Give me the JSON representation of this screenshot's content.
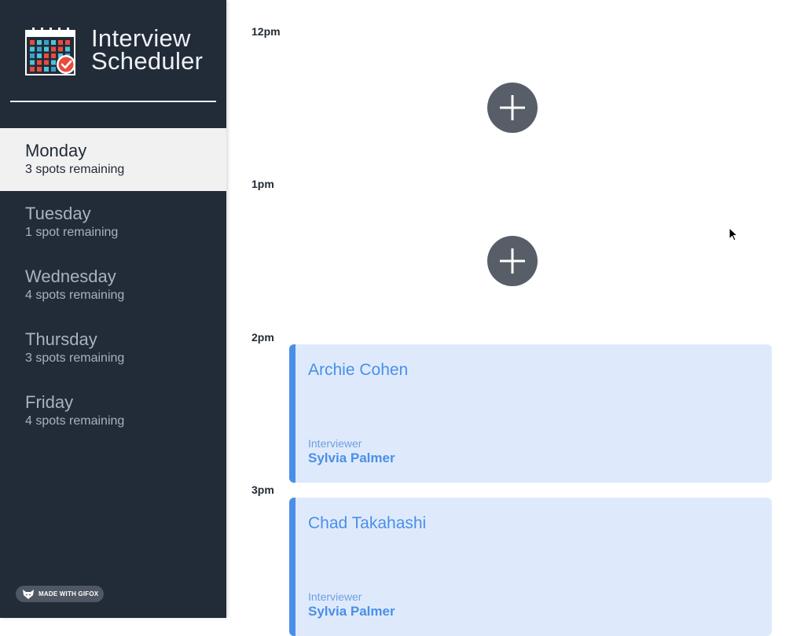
{
  "app": {
    "title_line1": "Interview",
    "title_line2": "Scheduler",
    "logo_icon": "calendar-check-icon"
  },
  "days": [
    {
      "name": "Monday",
      "spots": "3 spots remaining",
      "selected": true
    },
    {
      "name": "Tuesday",
      "spots": "1 spot remaining",
      "selected": false
    },
    {
      "name": "Wednesday",
      "spots": "4 spots remaining",
      "selected": false
    },
    {
      "name": "Thursday",
      "spots": "3 spots remaining",
      "selected": false
    },
    {
      "name": "Friday",
      "spots": "4 spots remaining",
      "selected": false
    }
  ],
  "slots": [
    {
      "time": "12pm",
      "booked": false,
      "add_icon": "plus-icon"
    },
    {
      "time": "1pm",
      "booked": false,
      "add_icon": "plus-icon"
    },
    {
      "time": "2pm",
      "booked": true,
      "student": "Archie Cohen",
      "interviewer_label": "Interviewer",
      "interviewer": "Sylvia Palmer"
    },
    {
      "time": "3pm",
      "booked": true,
      "student": "Chad Takahashi",
      "interviewer_label": "Interviewer",
      "interviewer": "Sylvia Palmer"
    }
  ],
  "watermark": {
    "text": "MADE WITH GIFOX",
    "icon": "fox-icon"
  },
  "colors": {
    "sidebar_bg": "#222b38",
    "selected_day_bg": "#f1f1f1",
    "appointment_bg": "#deeafc",
    "appointment_accent": "#4a8fe7",
    "add_button": "#575e67"
  }
}
